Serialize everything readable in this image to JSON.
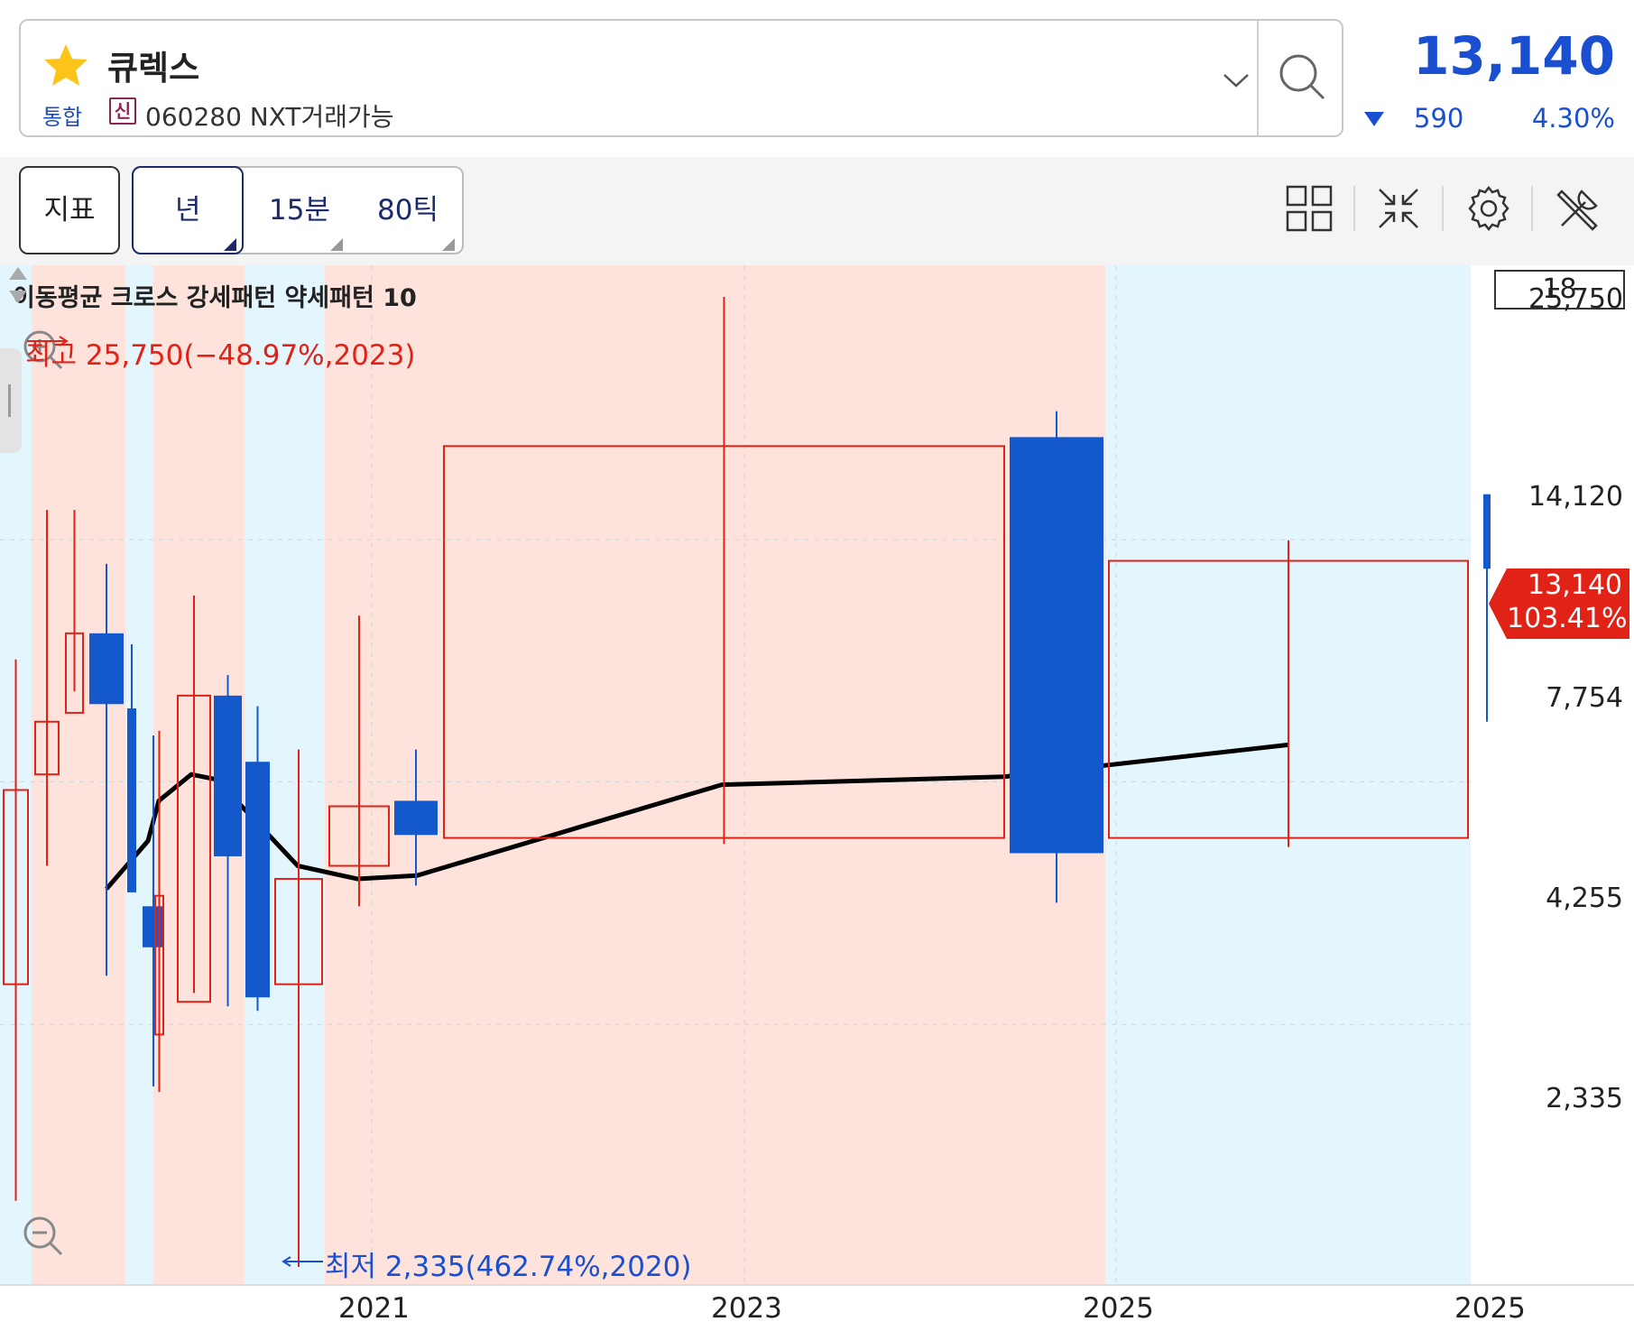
{
  "header": {
    "stock_name": "큐렉스",
    "market": "통합",
    "credit_badge": "신",
    "code_line": "060280 NXT거래가능",
    "price": "13,140",
    "change": "590",
    "change_pct": "4.30%",
    "change_direction": "down",
    "icons": [
      "star-icon",
      "chevron-down-icon",
      "search-icon"
    ]
  },
  "toolbar": {
    "indicator_label": "지표",
    "periods": [
      {
        "label": "년",
        "active": true
      },
      {
        "label": "15분",
        "active": false
      },
      {
        "label": "80틱",
        "active": false
      }
    ],
    "tools": [
      "layout-grid-icon",
      "collapse-icon",
      "settings-gear-icon",
      "tools-icon"
    ]
  },
  "chart": {
    "legend": "이동평균 크로스 강세패턴 약세패턴 10",
    "high_label": "최고 25,750(−48.97%,2023)",
    "low_label": "최저 2,335(462.74%,2020)",
    "count": "18",
    "current_price_label": "13,140",
    "current_pct_label": "103.41%",
    "y_ticks": [
      "25,750",
      "14,120",
      "7,754",
      "4,255",
      "2,335"
    ],
    "x_ticks": [
      "2021",
      "2023",
      "2025",
      "2025"
    ],
    "colors": {
      "up": "#e02217",
      "down": "#1459cc",
      "bull_zone": "#fde3dc",
      "bear_zone": "#e4f6fd",
      "ma_line": "#000000"
    }
  },
  "chart_data": {
    "type": "candlestick",
    "y_scale": "log",
    "ylim": [
      2335,
      25750
    ],
    "ma_period": 10,
    "candles": [
      {
        "open": 4700,
        "high": 10500,
        "low": 2750,
        "close": 7600,
        "dir": "up"
      },
      {
        "open": 7900,
        "high": 15200,
        "low": 6300,
        "close": 9000,
        "dir": "up"
      },
      {
        "open": 9200,
        "high": 15200,
        "low": 9700,
        "close": 11200,
        "dir": "up"
      },
      {
        "open": 11200,
        "high": 13300,
        "low": 4800,
        "close": 9400,
        "dir": "down"
      },
      {
        "open": 9300,
        "high": 10900,
        "low": 5900,
        "close": 5900,
        "dir": "down"
      },
      {
        "open": 5150,
        "high": 8700,
        "low": 3650,
        "close": 5700,
        "dir": "down"
      },
      {
        "open": 4150,
        "high": 8800,
        "low": 3600,
        "close": 5850,
        "dir": "up"
      },
      {
        "open": 4500,
        "high": 12300,
        "low": 4600,
        "close": 9600,
        "dir": "up"
      },
      {
        "open": 9600,
        "high": 10100,
        "low": 4450,
        "close": 6450,
        "dir": "down"
      },
      {
        "open": 8150,
        "high": 9350,
        "low": 4400,
        "close": 4550,
        "dir": "down"
      },
      {
        "open": 4700,
        "high": 8400,
        "low": 2335,
        "close": 6100,
        "dir": "up"
      },
      {
        "open": 6300,
        "high": 11700,
        "low": 5700,
        "close": 7300,
        "dir": "up"
      },
      {
        "open": 6800,
        "high": 8400,
        "low": 6000,
        "close": 7400,
        "dir": "down"
      },
      {
        "open": 6750,
        "high": 25750,
        "low": 6650,
        "close": 17800,
        "dir": "up"
      },
      {
        "open": 18200,
        "high": 19400,
        "low": 5750,
        "close": 6500,
        "dir": "down"
      },
      {
        "open": 6750,
        "high": 14100,
        "low": 6600,
        "close": 13400,
        "dir": "up"
      },
      {
        "open": 15800,
        "high": 15800,
        "low": 9000,
        "close": 13140,
        "dir": "down"
      }
    ],
    "moving_average": [
      5950,
      6700,
      7400,
      7900,
      7800,
      6300,
      6100,
      6150,
      7700,
      7854,
      8500
    ],
    "x_labels": [
      "2021",
      "2023",
      "2025",
      "2025"
    ],
    "bands": [
      "bull",
      "bear",
      "bull",
      "bear",
      "bull",
      "bear"
    ]
  }
}
